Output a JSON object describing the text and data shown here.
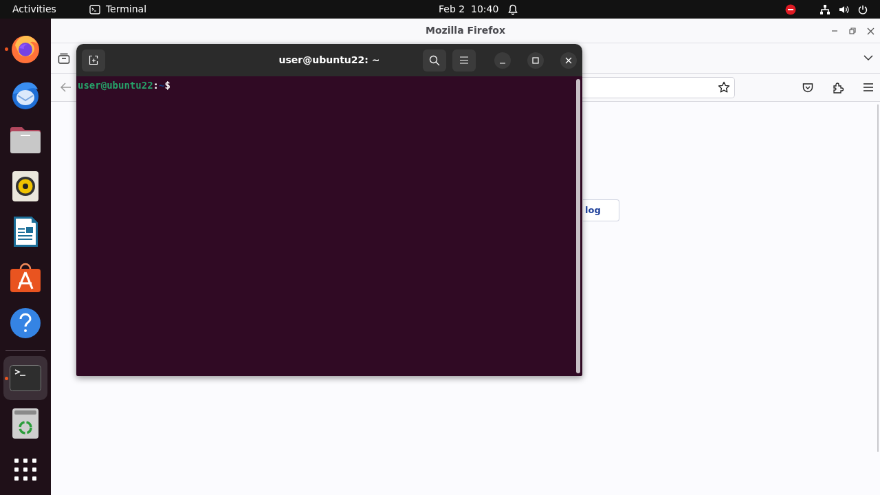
{
  "topbar": {
    "activities": "Activities",
    "app_menu": "Terminal",
    "clock": "Feb 2  10:40"
  },
  "dock": {
    "items": [
      {
        "kind": "firefox",
        "running": true,
        "selected": false
      },
      {
        "kind": "thunderbird",
        "running": false,
        "selected": false
      },
      {
        "kind": "files",
        "running": false,
        "selected": false
      },
      {
        "kind": "rhythmbox",
        "running": false,
        "selected": false
      },
      {
        "kind": "writer",
        "running": false,
        "selected": false
      },
      {
        "kind": "appcenter",
        "running": false,
        "selected": false
      },
      {
        "kind": "help",
        "running": false,
        "selected": false
      },
      {
        "kind": "separator"
      },
      {
        "kind": "terminal",
        "running": true,
        "selected": true
      },
      {
        "kind": "trash",
        "running": false,
        "selected": false
      },
      {
        "kind": "apps",
        "running": false,
        "selected": false
      }
    ]
  },
  "firefox": {
    "title": "Mozilla Firefox",
    "page_button": "log"
  },
  "terminal": {
    "title": "user@ubuntu22: ~",
    "prompt": {
      "user_host": "user@ubuntu22",
      "separator": ":",
      "path": "~",
      "symbol": "$"
    }
  }
}
